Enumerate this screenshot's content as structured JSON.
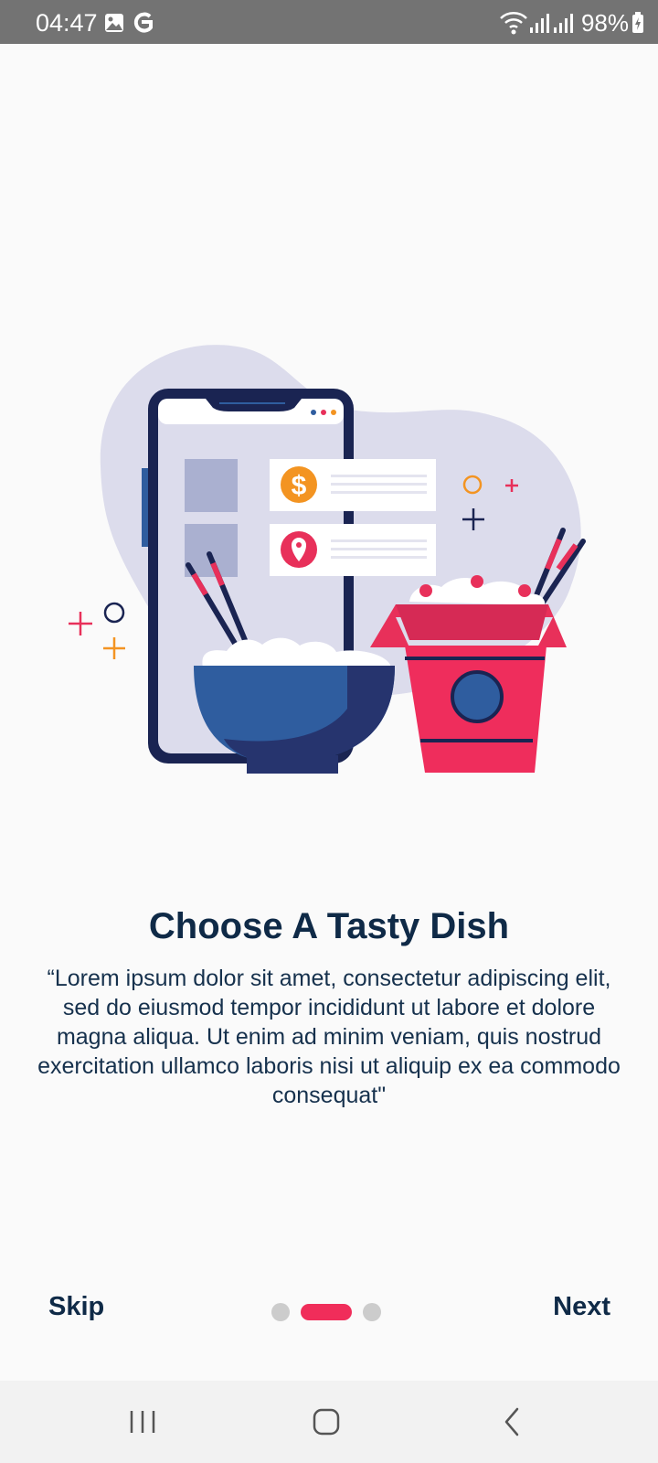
{
  "status_bar": {
    "time": "04:47",
    "left_icons": [
      "image-icon",
      "google-icon"
    ],
    "right_icons": [
      "wifi-icon",
      "signal-icon",
      "signal-icon",
      "battery-charging-icon"
    ],
    "battery": "98%"
  },
  "illustration": {
    "name": "food-order-illustration",
    "colors": {
      "blob": "#dcdcec",
      "navy": "#1a2452",
      "blue": "#2f5d9f",
      "red": "#e8305a",
      "orange": "#f39422",
      "tile": "#aab0d0"
    }
  },
  "onboarding": {
    "title": "Choose A Tasty Dish",
    "description": "“Lorem ipsum dolor sit amet, consectetur adipiscing elit, sed do eiusmod tempor incididunt ut labore et dolore magna aliqua. Ut enim ad minim veniam, quis nostrud exercitation ullamco laboris nisi ut aliquip ex ea commodo consequat\""
  },
  "footer": {
    "skip_label": "Skip",
    "next_label": "Next",
    "page_count": 3,
    "active_page": 2
  },
  "nav_bar": {
    "buttons": [
      "recent-apps-icon",
      "home-icon",
      "back-icon"
    ]
  }
}
